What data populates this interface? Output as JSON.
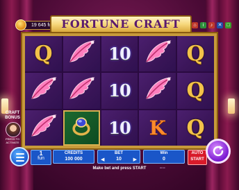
{
  "header": {
    "balance": "19 645 fun",
    "title": "FORTUNE CRAFT"
  },
  "reels": [
    [
      "Q",
      "feather",
      "10",
      "feather",
      "Q"
    ],
    [
      "feather",
      "feather",
      "10",
      "feather",
      "Q"
    ],
    [
      "feather",
      "ring",
      "10",
      "K",
      "Q"
    ]
  ],
  "bonus": {
    "label": "CRAFT BONUS",
    "press": "PRESS TO ACTIVATE"
  },
  "controls": {
    "lines_value": "1",
    "lines_unit": "fun",
    "credits_label": "CREDITS",
    "credits_value": "100 000",
    "bet_label": "BET",
    "bet_value": "10",
    "win_label": "Win",
    "win_value": "0",
    "autostart_label": "AUTO START",
    "message": "Make bet and press START",
    "footer": "00:00"
  },
  "colors": {
    "gold": "#c79a3a",
    "panel_blue": "#1a56c8",
    "autostart_red": "#d81a2a",
    "spin_purple": "#7a1ad0"
  }
}
